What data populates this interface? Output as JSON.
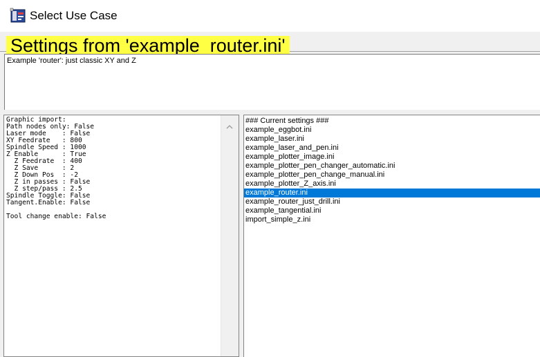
{
  "window": {
    "title": "Select Use Case",
    "icon": "app-icon"
  },
  "banner": {
    "text": "Settings from 'example_router.ini'",
    "color": "#ffff44"
  },
  "description": {
    "text": "Example 'router': just classic XY and Z"
  },
  "settings": {
    "lines": [
      "Graphic import:",
      "Path nodes only: False",
      "Laser mode    : False",
      "XY Feedrate   : 800",
      "Spindle Speed : 1000",
      "Z Enable      : True",
      "  Z Feedrate  : 400",
      "  Z Save      : 2",
      "  Z Down Pos  : -2",
      "  Z in passes : False",
      "  Z step/pass : 2.5",
      "Spindle Toggle: False",
      "Tangent.Enable: False",
      "",
      "Tool change enable: False"
    ]
  },
  "files": {
    "items": [
      "### Current settings ###",
      "example_eggbot.ini",
      "example_laser.ini",
      "example_laser_and_pen.ini",
      "example_plotter_image.ini",
      "example_plotter_pen_changer_automatic.ini",
      "example_plotter_pen_change_manual.ini",
      "example_plotter_Z_axis.ini",
      "example_router.ini",
      "example_router_just_drill.ini",
      "example_tangential.ini",
      "import_simple_z.ini"
    ],
    "selected_index": 8,
    "selection_color": "#0078d7"
  }
}
